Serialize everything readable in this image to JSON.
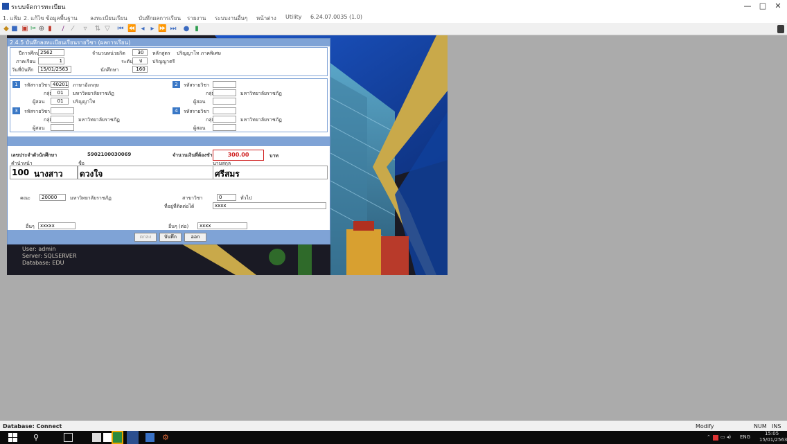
{
  "window": {
    "title": "ระบบจัดการทะเบียน",
    "minimize": "—",
    "maximize": "□",
    "close": "✕"
  },
  "menu": {
    "items": [
      "1. แฟ้ม",
      "2. แก้ไข",
      "ข้อมูลพื้นฐาน",
      "ลงทะเบียนเรียน",
      "บันทึกผลการเรียน",
      "รายงาน",
      "ระบบงานอื่นๆ",
      "หน้าต่าง",
      "Utility",
      "6.24.07.0035 (1.0)"
    ]
  },
  "toolbar": {
    "icons": [
      "save-icon",
      "print-icon",
      "copy-icon",
      "cut-icon",
      "paste-icon",
      "edit-icon",
      "cancel-icon",
      "delete-icon",
      "filter-icon",
      "first-record-icon",
      "prev-record-icon",
      "next-record-icon",
      "last-record-icon",
      "find-icon",
      "exit-icon"
    ]
  },
  "dialog": {
    "title": "2.4.5 บันทึกลงทะเบียนเรียนรายวิชา (ผลการเรียน)",
    "header": {
      "year_label": "ปีการศึกษา",
      "year_value": "2562",
      "term_label": "ภาคเรียน",
      "term_value": "1",
      "date_label": "วันที่บันทึก",
      "date_value": "15/01/2563",
      "credit_label": "จำนวนหน่วยกิต",
      "credit_value": "30",
      "level_label": "ระดับ",
      "level_value": "ป",
      "level_text": "ปริญญาตรี",
      "studentcount_label": "นักศึกษา",
      "studentcount_value": "160",
      "program_label": "หลักสูตร",
      "program_value": "ปริญญาโท ภาคพิเศษ"
    },
    "subjects": [
      {
        "num": "1",
        "code_label": "รหัสรายวิชา",
        "code_value": "40201",
        "name": "ภาษาอังกฤษ",
        "group_label": "กลุ่ม",
        "group_value": "01",
        "group_text": "มหาวิทยาลัยราชภัฏ",
        "teacher_label": "ผู้สอน",
        "teacher_value": "01",
        "teacher_text": "ปริญญาโท"
      },
      {
        "num": "2",
        "code_label": "รหัสรายวิชา",
        "code_value": "",
        "name": "",
        "group_label": "กลุ่ม",
        "group_value": "",
        "group_text": "มหาวิทยาลัยราชภัฏ",
        "teacher_label": "ผู้สอน",
        "teacher_value": "",
        "teacher_text": ""
      },
      {
        "num": "3",
        "code_label": "รหัสรายวิชา",
        "code_value": "",
        "name": "",
        "group_label": "กลุ่ม",
        "group_value": "",
        "group_text": "มหาวิทยาลัยราชภัฏ",
        "teacher_label": "ผู้สอน",
        "teacher_value": "",
        "teacher_text": ""
      },
      {
        "num": "4",
        "code_label": "รหัสรายวิชา",
        "code_value": "",
        "name": "",
        "group_label": "กลุ่ม",
        "group_value": "",
        "group_text": "มหาวิทยาลัยราชภัฏ",
        "teacher_label": "ผู้สอน",
        "teacher_value": "",
        "teacher_text": ""
      }
    ],
    "student": {
      "id_label": "เลขประจำตัวนักศึกษา",
      "id_value": "5902100030069",
      "amount_label": "จำนวนเงินที่ต้องชำระ",
      "amount_value": "300.00",
      "amount_unit": "บาท",
      "prefix_label": "คำนำหน้า",
      "name_label": "ชื่อ",
      "surname_label": "นามสกุล",
      "code": "100",
      "prefix": "นางสาว",
      "firstname": "ดวงใจ",
      "surname": "ศรีสมร"
    },
    "extra": {
      "faculty_label": "คณะ",
      "faculty_value": "20000",
      "faculty_text": "มหาวิทยาลัยราชภัฏ",
      "major_label": "สาขาวิชา",
      "major_value": "0",
      "major_text": "ทั่วไป",
      "address_label": "ที่อยู่ที่ติดต่อได้",
      "address_value": "xxxx",
      "note1_label": "อื่นๆ",
      "note1_value": "xxxxx",
      "note2_label": "อื่นๆ (ต่อ)",
      "note2_value": "xxxx"
    },
    "buttons": {
      "ok": "ตกลง",
      "save": "บันทึก",
      "cancel": "ออก"
    }
  },
  "background_text": {
    "line1": "User: admin",
    "line2": "Server: SQLSERVER",
    "line3": "Database: EDU"
  },
  "statusbar": {
    "left": "Database: Connect",
    "mode": "Modify",
    "num1": "NUM",
    "num2": "INS"
  },
  "taskbar": {
    "icons": [
      "windows-start-icon",
      "search-icon",
      "task-view-icon",
      "file-explorer-icon",
      "store-icon",
      "chrome-icon",
      "app-icon",
      "app2-icon",
      "app3-icon"
    ],
    "tray_lang": "ENG",
    "time": "15:05",
    "date": "15/01/2563"
  }
}
